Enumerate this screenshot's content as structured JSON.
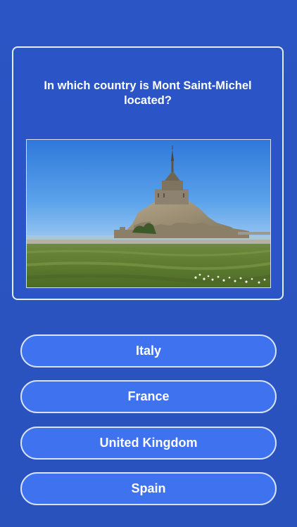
{
  "question": {
    "text": "In which country is Mont Saint-Michel located?",
    "image": "mont-saint-michel-photo"
  },
  "answers": [
    {
      "label": "Italy"
    },
    {
      "label": "France"
    },
    {
      "label": "United Kingdom"
    },
    {
      "label": "Spain"
    }
  ],
  "colors": {
    "background": "#2b55c4",
    "card_border": "#e6ecff",
    "button_fill": "#3f72ee",
    "button_border": "#d9e3ff",
    "text": "#ffffff"
  }
}
